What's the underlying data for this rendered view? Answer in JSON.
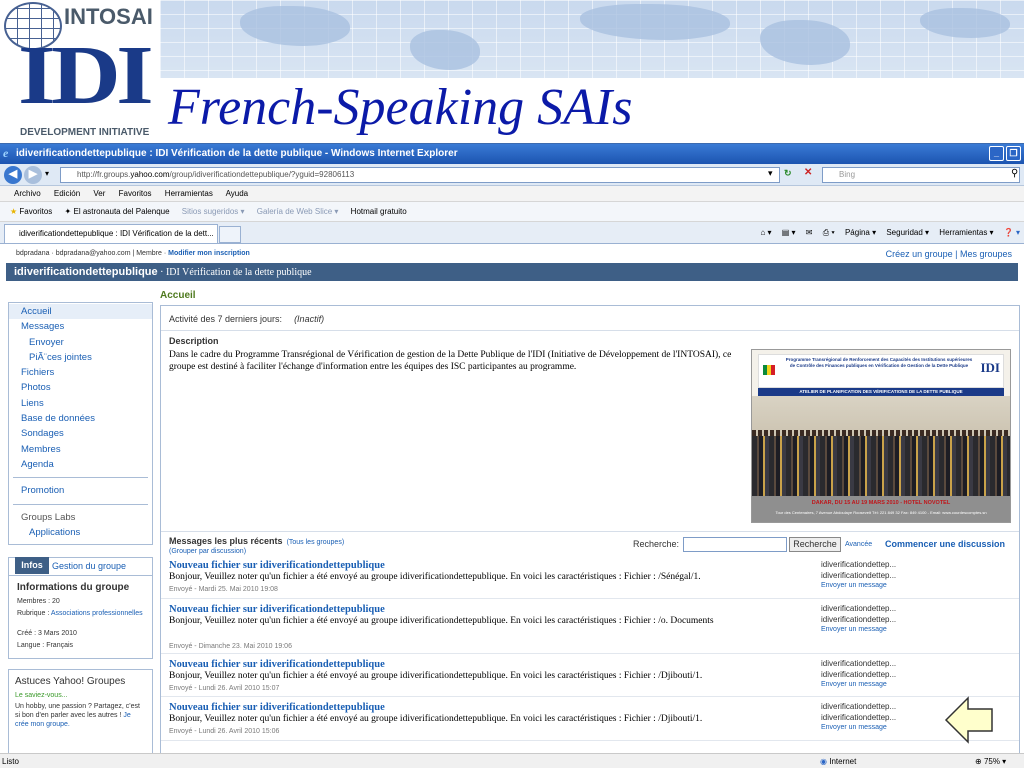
{
  "slide": {
    "logo_org": "INTOSAI",
    "logo_main": "IDI",
    "logo_sub": "DEVELOPMENT INITIATIVE",
    "title": "French-Speaking SAIs"
  },
  "browser": {
    "window_title": "idiverificationdettepublique : IDI Vérification de la dette publique - Windows Internet Explorer",
    "url_prefix": "http://fr.groups.",
    "url_domain": "yahoo.com",
    "url_path": "/group/idiverificationdettepublique/?yguid=92806113",
    "search_placeholder": "Bing",
    "menu": [
      "Archivo",
      "Edición",
      "Ver",
      "Favoritos",
      "Herramientas",
      "Ayuda"
    ],
    "favorites": {
      "label": "Favoritos",
      "items": [
        "El astronauta del Palenque",
        "Sitios sugeridos ▾",
        "Galería de Web Slice ▾",
        "Hotmail gratuito"
      ]
    },
    "tab_label": "idiverificationdettepublique : IDI Vérification de la dett...",
    "commands": [
      "Página ▾",
      "Seguridad ▾",
      "Herramientas ▾"
    ],
    "status_left": "Listo",
    "status_zone": "Internet",
    "status_zoom": "75%"
  },
  "group": {
    "user_line": "bdpradana · bdpradana@yahoo.com | Membre · ",
    "modify_link": "Modifier mon inscription",
    "top_right": "Créez un groupe | Mes groupes",
    "name": "idiverificationdettepublique",
    "subtitle": " · IDI Vérification de la dette publique"
  },
  "sidebar": {
    "nav1": [
      "Accueil",
      "Messages",
      "Envoyer",
      "PiÃ¨ces jointes",
      "Fichiers",
      "Photos",
      "Liens",
      "Base de données",
      "Sondages",
      "Membres",
      "Agenda"
    ],
    "nav2": [
      "Promotion"
    ],
    "nav3": [
      "Groups Labs",
      "Applications"
    ],
    "infos_tab": "Infos",
    "gestion_tab": "Gestion du groupe",
    "info_title": "Informations du groupe",
    "members": "Membres : 20",
    "rubrique_label": "Rubrique : ",
    "rubrique_value": "Associations professionnelles",
    "created": "Créé : 3 Mars 2010",
    "language": "Langue : Français",
    "astuces_title": "Astuces Yahoo! Groupes",
    "astuces_q": "Le saviez-vous...",
    "astuces_text": "Un hobby, une passion ? Partagez, c'est si bon d'en parler avec les autres ! ",
    "astuces_link": "Je crée mon groupe."
  },
  "main": {
    "title": "Accueil",
    "activity_label": "Activité des 7 derniers jours:",
    "activity_value": "(Inactif)",
    "description_label": "Description",
    "description_text": "Dans le cadre du Programme Transrégional de Vérification de gestion de la Dette Publique de l'IDI (Initiative de Développement de l'INTOSAI), ce groupe est destiné à faciliter l'échange d'information entre les équipes des ISC participantes au programme.",
    "photo": {
      "banner_text": "Programme Transrégional de Renforcement des Capacités des Institutions supérieures de Contrôle des Finances publiques en Vérification de Gestion de la Dette Publique",
      "banner_logo": "IDI",
      "subbanner": "ATELIER DE PLANIFICATION DES VÉRIFICATIONS DE LA DETTE PUBLIQUE",
      "caption": "DAKAR, DU 15 AU 19 MARS 2010 - HOTEL NOVOTEL",
      "caption2": "Tour des Centenaires, 7 Avenue Abdoulaye Roosevelt Tél: 221 849 32 Fax: 849 4100 - Email: www.courdescomptes.sn"
    },
    "messages_title": "Messages les plus récents",
    "all_groups_link": "(Tous les groupes)",
    "group_by_link": "(Grouper par discussion)",
    "search_label": "Recherche:",
    "search_button": "Recherche",
    "advanced_link": "Avancée",
    "start_discussion": "Commencer une discussion",
    "messages": [
      {
        "title": "Nouveau fichier sur idiverificationdettepublique",
        "body": "Bonjour, Veuillez noter qu'un fichier a été envoyé au groupe idiverificationdettepublique. En voici les caractéristiques : Fichier : /Sénégal/1.",
        "date": "Envoyé - Mardi 25. Mai 2010  19:08",
        "from1": "idiverificationdettep...",
        "from2": "idiverificationdettep...",
        "send": "Envoyer un message"
      },
      {
        "title": "Nouveau fichier sur idiverificationdettepublique",
        "body": "Bonjour, Veuillez noter qu'un fichier a été envoyé au groupe idiverificationdettepublique. En voici les caractéristiques : Fichier : /o. Documents",
        "date": "Envoyé - Dimanche 23. Mai 2010  19:06",
        "from1": "idiverificationdettep...",
        "from2": "idiverificationdettep...",
        "send": "Envoyer un message"
      },
      {
        "title": "Nouveau fichier sur idiverificationdettepublique",
        "body": "Bonjour, Veuillez noter qu'un fichier a été envoyé au groupe idiverificationdettepublique. En voici les caractéristiques : Fichier : /Djibouti/1.",
        "date": "Envoyé - Lundi 26. Avril 2010  15:07",
        "from1": "idiverificationdettep...",
        "from2": "idiverificationdettep...",
        "send": "Envoyer un message"
      },
      {
        "title": "Nouveau fichier sur idiverificationdettepublique",
        "body": "Bonjour, Veuillez noter qu'un fichier a été envoyé au groupe idiverificationdettepublique. En voici les caractéristiques : Fichier : /Djibouti/1.",
        "date": "Envoyé - Lundi 26. Avril 2010  15:06",
        "from1": "idiverificationdettep...",
        "from2": "idiverificationdettep...",
        "send": "Envoyer un message"
      }
    ]
  },
  "colors": {
    "title_blue": "#0b1aa8",
    "group_bar": "#3e5f86",
    "link_blue": "#1a5fb4",
    "accueil_green": "#4f7a1f",
    "arrow_fill": "#ffffcc"
  },
  "icons": [
    "globe-icon",
    "back-icon",
    "forward-icon",
    "refresh-icon",
    "stop-icon",
    "search-icon",
    "star-icon",
    "home-icon",
    "print-icon",
    "help-icon",
    "left-arrow-icon"
  ]
}
